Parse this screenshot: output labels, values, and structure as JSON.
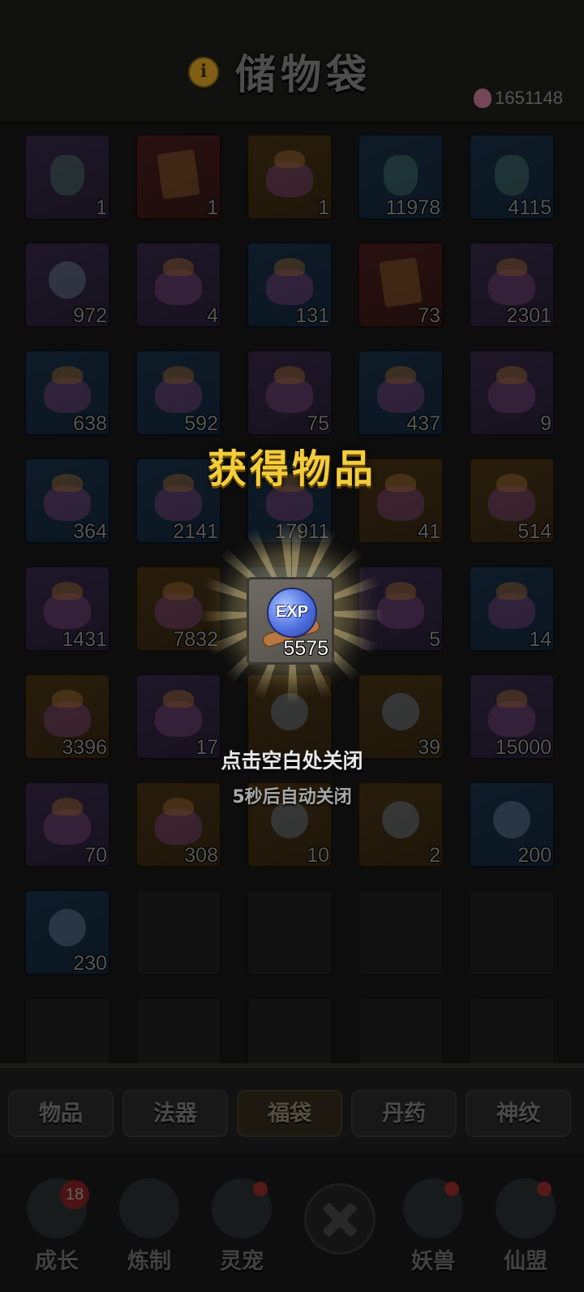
{
  "header": {
    "info_icon": "info-icon",
    "title": "储物袋",
    "currency": {
      "icon": "gem-icon",
      "value": "1651148"
    }
  },
  "inventory": [
    {
      "count": "1",
      "color": "purple",
      "icon": "jar"
    },
    {
      "count": "1",
      "color": "red",
      "icon": "book"
    },
    {
      "count": "1",
      "color": "orange",
      "icon": "bag"
    },
    {
      "count": "11978",
      "color": "blue",
      "icon": "jar"
    },
    {
      "count": "4115",
      "color": "blue",
      "icon": "jar"
    },
    {
      "count": "972",
      "color": "purple",
      "icon": "orb"
    },
    {
      "count": "4",
      "color": "purple",
      "icon": "bag"
    },
    {
      "count": "131",
      "color": "blue",
      "icon": "bag"
    },
    {
      "count": "73",
      "color": "red",
      "icon": "book"
    },
    {
      "count": "2301",
      "color": "purple",
      "icon": "bag"
    },
    {
      "count": "638",
      "color": "blue",
      "icon": "bag"
    },
    {
      "count": "592",
      "color": "blue",
      "icon": "bag"
    },
    {
      "count": "75",
      "color": "purple",
      "icon": "bag"
    },
    {
      "count": "437",
      "color": "blue",
      "icon": "bag"
    },
    {
      "count": "9",
      "color": "purple",
      "icon": "bag"
    },
    {
      "count": "364",
      "color": "blue",
      "icon": "bag"
    },
    {
      "count": "2141",
      "color": "blue",
      "icon": "bag"
    },
    {
      "count": "17911",
      "color": "blue",
      "icon": "bag"
    },
    {
      "count": "41",
      "color": "orange",
      "icon": "bag"
    },
    {
      "count": "514",
      "color": "orange",
      "icon": "bag"
    },
    {
      "count": "1431",
      "color": "purple",
      "icon": "bag"
    },
    {
      "count": "7832",
      "color": "orange",
      "icon": "bag"
    },
    {
      "count": "",
      "color": "blue",
      "icon": "bag"
    },
    {
      "count": "5",
      "color": "purple",
      "icon": "bag"
    },
    {
      "count": "14",
      "color": "blue",
      "icon": "bag"
    },
    {
      "count": "3396",
      "color": "orange",
      "icon": "bag"
    },
    {
      "count": "17",
      "color": "purple",
      "icon": "bag"
    },
    {
      "count": "",
      "color": "orange",
      "icon": "orb"
    },
    {
      "count": "39",
      "color": "orange",
      "icon": "orb"
    },
    {
      "count": "15000",
      "color": "purple",
      "icon": "bag"
    },
    {
      "count": "70",
      "color": "purple",
      "icon": "bag"
    },
    {
      "count": "308",
      "color": "orange",
      "icon": "bag"
    },
    {
      "count": "10",
      "color": "orange",
      "icon": "orb"
    },
    {
      "count": "2",
      "color": "orange",
      "icon": "orb"
    },
    {
      "count": "200",
      "color": "blue",
      "icon": "orb"
    },
    {
      "count": "230",
      "color": "blue",
      "icon": "orb"
    },
    {
      "count": "",
      "color": "empty",
      "icon": ""
    },
    {
      "count": "",
      "color": "empty",
      "icon": ""
    },
    {
      "count": "",
      "color": "empty",
      "icon": ""
    },
    {
      "count": "",
      "color": "empty",
      "icon": ""
    },
    {
      "count": "",
      "color": "empty",
      "icon": ""
    },
    {
      "count": "",
      "color": "empty",
      "icon": ""
    },
    {
      "count": "",
      "color": "empty",
      "icon": ""
    },
    {
      "count": "",
      "color": "empty",
      "icon": ""
    },
    {
      "count": "",
      "color": "empty",
      "icon": ""
    }
  ],
  "tabs": [
    {
      "label": "物品",
      "active": false
    },
    {
      "label": "法器",
      "active": false
    },
    {
      "label": "福袋",
      "active": true
    },
    {
      "label": "丹药",
      "active": false
    },
    {
      "label": "神纹",
      "active": false
    }
  ],
  "nav": {
    "growth": {
      "label": "成长",
      "badge": "18"
    },
    "forge": {
      "label": "炼制"
    },
    "pet": {
      "label": "灵宠"
    },
    "close": {
      "icon": "close-icon"
    },
    "beast": {
      "label": "妖兽"
    },
    "alliance": {
      "label": "仙盟"
    }
  },
  "popup": {
    "title": "获得物品",
    "reward": {
      "icon_text": "EXP",
      "count": "5575"
    },
    "hint": "点击空白处关闭",
    "auto_close": "5秒后自动关闭"
  }
}
